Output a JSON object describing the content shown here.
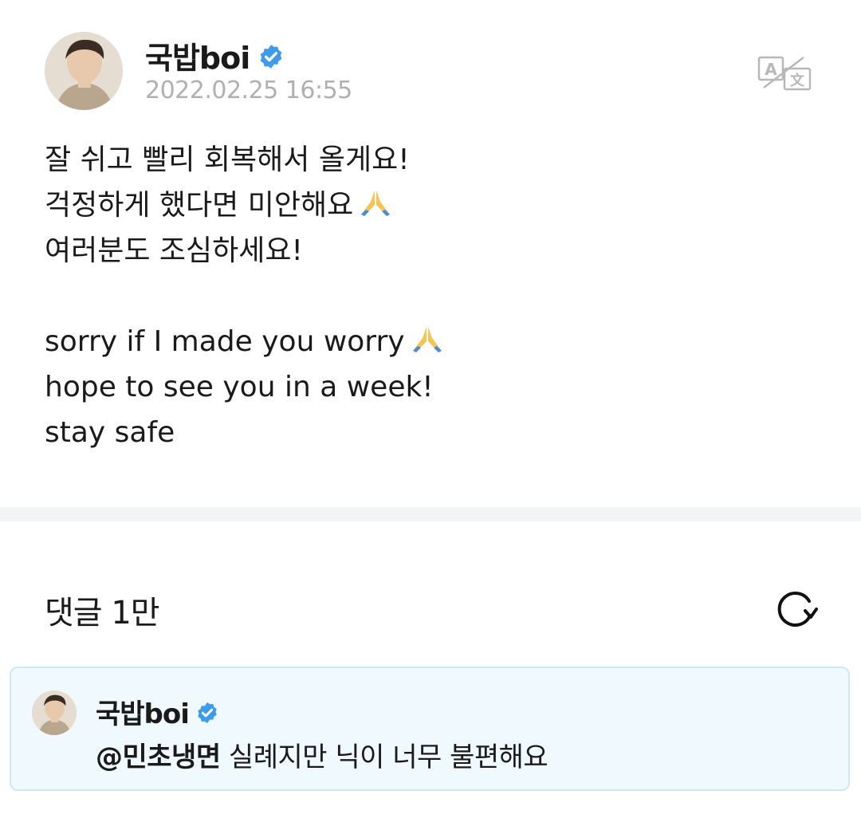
{
  "post": {
    "author": "국밥boi",
    "timestamp": "2022.02.25 16:55",
    "lines": [
      "잘 쉬고 빨리 회복해서 올게요!",
      "걱정하게 했다면 미안해요",
      "여러분도 조심하세요!",
      "",
      "sorry if I made you worry",
      "hope to see you in a week!",
      "stay safe"
    ]
  },
  "icons": {
    "verified": "verified-badge-icon",
    "translate": "translate-icon",
    "prayer": "folded-hands-emoji",
    "refresh": "refresh-icon"
  },
  "comments": {
    "header": "댓글 1만",
    "pinned": {
      "author": "국밥boi",
      "mention": "@민초냉면",
      "text": " 실례지만 닉이 너무 불편해요"
    }
  },
  "colors": {
    "verified_blue": "#3d9be9",
    "timestamp_gray": "#b0b0b0",
    "pinned_bg": "#f0f9fe",
    "pinned_border": "#cfe9f3",
    "divider": "#f3f4f6"
  }
}
